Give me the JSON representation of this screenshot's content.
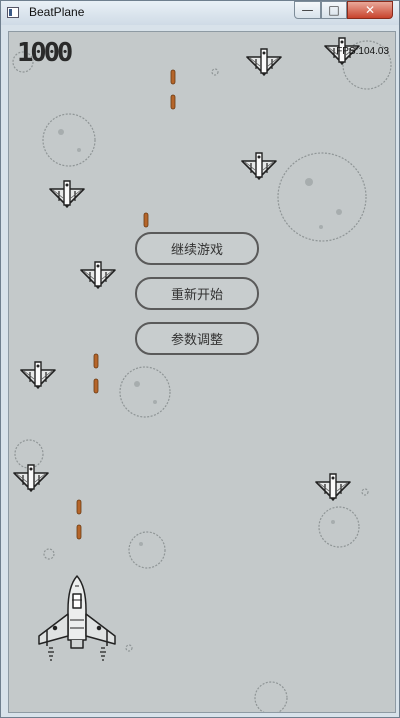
{
  "window": {
    "title": "BeatPlane",
    "min_glyph": "—",
    "max_glyph": "□",
    "close_glyph": "✕"
  },
  "hud": {
    "score": "1000",
    "fps": "FPS:104.03"
  },
  "menu": {
    "resume": "继续游戏",
    "restart": "重新开始",
    "settings": "参数调整"
  },
  "colors": {
    "background": "#c4c9ca",
    "bullet": "#b5652a",
    "ink": "#2a2a2a"
  }
}
